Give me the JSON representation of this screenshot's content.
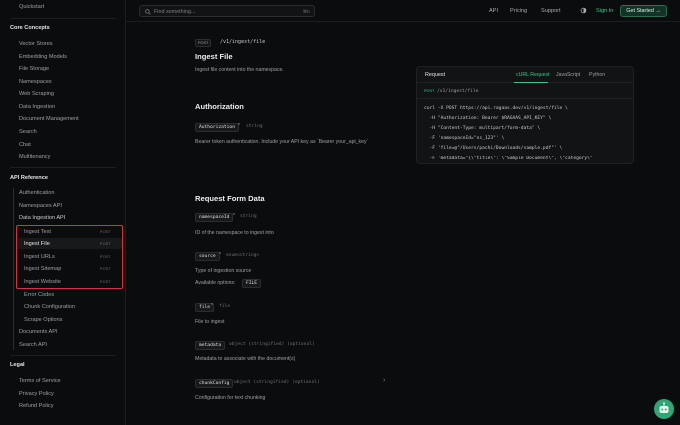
{
  "sidebar": {
    "top_item": "Quickstart",
    "core_title": "Core Concepts",
    "core_items": [
      "Vector Stores",
      "Embedding Models",
      "File Storage",
      "Namespaces",
      "Web Scraping",
      "Data Ingestion",
      "Document Management",
      "Search",
      "Chat",
      "Multitenancy"
    ],
    "api_title": "API Reference",
    "api_items": [
      "Authentication",
      "Namespaces API",
      "Data Ingestion API"
    ],
    "ingestion_sub": [
      {
        "label": "Ingest Text",
        "method": "POST"
      },
      {
        "label": "Ingest File",
        "method": "POST"
      },
      {
        "label": "Ingest URLs",
        "method": "POST"
      },
      {
        "label": "Ingest Sitemap",
        "method": "POST"
      },
      {
        "label": "Ingest Website",
        "method": "POST"
      }
    ],
    "ingestion_sub_more": [
      "Error Codes",
      "Chunk Configuration",
      "Scrape Options"
    ],
    "api_items_after": [
      "Documents API",
      "Search API"
    ],
    "legal_title": "Legal",
    "legal_items": [
      "Terms of Service",
      "Privacy Policy",
      "Refund Policy"
    ]
  },
  "topbar": {
    "search_placeholder": "Find something...",
    "search_shortcut": "⌘K",
    "nav": [
      "API",
      "Pricing",
      "Support"
    ],
    "signin": "Sign In",
    "get_started": "Get Started →"
  },
  "main": {
    "method": "POST",
    "path": "/v1/ingest/file",
    "title": "Ingest File",
    "description": "Ingest file content into the namespace.",
    "auth_title": "Authorization",
    "auth_param": "Authorization",
    "auth_type": "string",
    "auth_desc": "Bearer token authentication. Include your API key as `Bearer your_api_key`",
    "form_title": "Request Form Data",
    "params": [
      {
        "name": "namespaceId",
        "required": "*",
        "type": "string",
        "desc": "ID of the namespace to ingest into"
      },
      {
        "name": "source",
        "required": "*",
        "type": "enum<string>",
        "desc": "Type of ingestion source",
        "extra_label": "Available options:",
        "extra_value": "FILE"
      },
      {
        "name": "file",
        "required": "*",
        "type": "file",
        "desc": "File to ingest"
      },
      {
        "name": "metadata",
        "required": "",
        "type": "object (stringified) (optional)",
        "desc": "Metadata to associate with the document(s)"
      },
      {
        "name": "chunkConfig",
        "required": "",
        "type": "object (stringified) (optional)",
        "desc": "Configuration for text chunking"
      }
    ]
  },
  "panel": {
    "title": "Request",
    "tabs": [
      "cURL Request",
      "JavaScript",
      "Python"
    ],
    "method": "POST",
    "path": "/v1/ingest/file",
    "code": [
      "curl -X POST https://api.ragaas.dev/v1/ingest/file \\",
      "  -H \"Authorization: Bearer $RAGAAS_API_KEY\" \\",
      "  -H \"Content-Type: multipart/form-data\" \\",
      "  -F 'namespaceId=\"ns_123\"' \\",
      "  -F 'file=@\"/Users/pachi/Downloads/sample.pdf\"' \\",
      "  -F 'metadata=\"{\\\"title\\\": \\\"Sample Document\\\", \\\"category\\\""
    ]
  },
  "colors": {
    "accent": "#38c98a",
    "highlight": "#d9303b",
    "background": "#0b0c0d"
  }
}
